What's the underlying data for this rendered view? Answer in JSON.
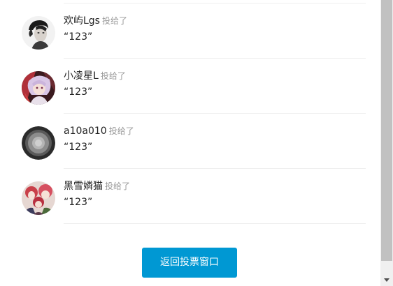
{
  "votes": [
    {
      "user": "欢屿Lgs",
      "verb": "投给了",
      "choice": "“123”",
      "avatar_icon": "portrait-avatar-icon"
    },
    {
      "user": "小凌星L",
      "verb": "投给了",
      "choice": "“123”",
      "avatar_icon": "anime-girl-avatar-icon"
    },
    {
      "user": "a10a010",
      "verb": "投给了",
      "choice": "“123”",
      "avatar_icon": "speaker-avatar-icon"
    },
    {
      "user": "黑雪嫾猫",
      "verb": "投给了",
      "choice": "“123”",
      "avatar_icon": "anime-group-avatar-icon"
    }
  ],
  "back_button": {
    "label": "返回投票窗口"
  },
  "colors": {
    "button_bg": "#0098d3",
    "button_text": "#ffffff",
    "verb_text": "#999999",
    "divider": "#eeeeee"
  }
}
